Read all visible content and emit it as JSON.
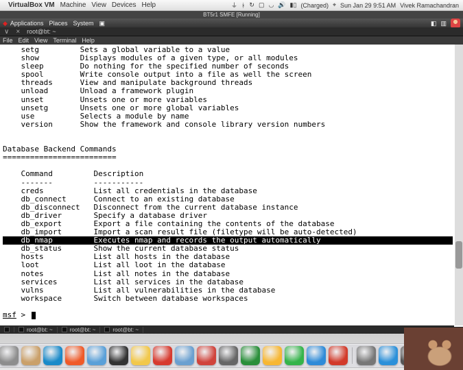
{
  "mac_menu": {
    "app": "VirtualBox VM",
    "items": [
      "Machine",
      "View",
      "Devices",
      "Help"
    ],
    "status_icons": [
      "bluetooth",
      "wifi",
      "speaker",
      "battery"
    ],
    "battery_text": "(Charged)",
    "clock": "Sun Jan 29  9:51 AM",
    "user": "Vivek Ramachandran"
  },
  "vm_title": "BT5r1 SMFE [Running]",
  "linux_panel": {
    "launcher_icon": "redhat-icon",
    "items": [
      "Applications",
      "Places",
      "System"
    ]
  },
  "term_tab": {
    "title": "root@bt: ~"
  },
  "term_menu": [
    "File",
    "Edit",
    "View",
    "Terminal",
    "Help"
  ],
  "core_cmds": [
    {
      "c": "setg",
      "d": "Sets a global variable to a value"
    },
    {
      "c": "show",
      "d": "Displays modules of a given type, or all modules"
    },
    {
      "c": "sleep",
      "d": "Do nothing for the specified number of seconds"
    },
    {
      "c": "spool",
      "d": "Write console output into a file as well the screen"
    },
    {
      "c": "threads",
      "d": "View and manipulate background threads"
    },
    {
      "c": "unload",
      "d": "Unload a framework plugin"
    },
    {
      "c": "unset",
      "d": "Unsets one or more variables"
    },
    {
      "c": "unsetg",
      "d": "Unsets one or more global variables"
    },
    {
      "c": "use",
      "d": "Selects a module by name"
    },
    {
      "c": "version",
      "d": "Show the framework and console library version numbers"
    }
  ],
  "db_title": "Database Backend Commands",
  "db_sep": "=========================",
  "db_hdr": {
    "c": "Command",
    "d": "Description"
  },
  "db_hdr_sep": {
    "c": "-------",
    "d": "-----------"
  },
  "db_cmds": [
    {
      "c": "creds",
      "d": "List all credentials in the database",
      "hl": false
    },
    {
      "c": "db_connect",
      "d": "Connect to an existing database",
      "hl": false
    },
    {
      "c": "db_disconnect",
      "d": "Disconnect from the current database instance",
      "hl": false
    },
    {
      "c": "db_driver",
      "d": "Specify a database driver",
      "hl": false
    },
    {
      "c": "db_export",
      "d": "Export a file containing the contents of the database",
      "hl": false
    },
    {
      "c": "db_import",
      "d": "Import a scan result file (filetype will be auto-detected)",
      "hl": false
    },
    {
      "c": "db_nmap",
      "d": "Executes nmap and records the output automatically",
      "hl": true
    },
    {
      "c": "db_status",
      "d": "Show the current database status",
      "hl": false
    },
    {
      "c": "hosts",
      "d": "List all hosts in the database",
      "hl": false
    },
    {
      "c": "loot",
      "d": "List all loot in the database",
      "hl": false
    },
    {
      "c": "notes",
      "d": "List all notes in the database",
      "hl": false
    },
    {
      "c": "services",
      "d": "List all services in the database",
      "hl": false
    },
    {
      "c": "vulns",
      "d": "List all vulnerabilities in the database",
      "hl": false
    },
    {
      "c": "workspace",
      "d": "Switch between database workspaces",
      "hl": false
    }
  ],
  "prompt": {
    "label": "msf",
    "sep": " > "
  },
  "taskbar": [
    "root@bt: ~",
    "root@bt: ~",
    "root@bt: ~"
  ],
  "dock_colors": [
    "#bfcde0",
    "#8d8d8d",
    "#caa06a",
    "#1a8ac9",
    "#f05a28",
    "#5aa0d8",
    "#333333",
    "#f2c84b",
    "#d73a2e",
    "#6aa0d0",
    "#d0433b",
    "#666666",
    "#2a8f3a",
    "#f7b733",
    "#34b44a",
    "#2e8bd8",
    "#d23a2a",
    "#777777",
    "#2b90d9",
    "#555555",
    "#9a9a9a",
    "#666666",
    "#444444"
  ]
}
